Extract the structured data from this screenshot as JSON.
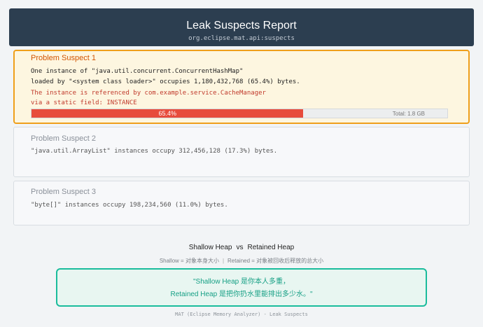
{
  "header": {
    "title": "Leak Suspects Report",
    "subtitle": "org.eclipse.mat.api:suspects"
  },
  "suspects": [
    {
      "title": "Problem Suspect 1",
      "line1": "One instance of \"java.util.concurrent.ConcurrentHashMap\"",
      "line2": "loaded by \"<system class loader>\" occupies 1,180,432,768 (65.4%) bytes.",
      "ref1": "The instance is referenced by com.example.service.CacheManager",
      "ref2": "via a static field: INSTANCE",
      "bar": {
        "fraction": 0.654,
        "label": "65.4%",
        "total": "Total: 1.8 GB"
      },
      "accent": "#ef9f1a"
    },
    {
      "title": "Problem Suspect 2",
      "line1": "\"java.util.ArrayList\" instances occupy 312,456,128 (17.3%) bytes."
    },
    {
      "title": "Problem Suspect 3",
      "line1": "\"byte[]\" instances occupy 198,234,560 (11.0%) bytes."
    }
  ],
  "heap": {
    "shallow": "Shallow Heap",
    "vs": "vs",
    "retained": "Retained Heap",
    "def_shallow": "Shallow = 对象本身大小",
    "sep": "|",
    "def_retained": "Retained = 对象被回收后释放的总大小",
    "quote_line1": "\"Shallow Heap 是你本人多重，",
    "quote_line2": "Retained Heap 是把你扔水里能排出多少水。\""
  },
  "footer": "MAT (Eclipse Memory Analyzer) - Leak Suspects",
  "colors": {
    "header_bg": "#2c3e50",
    "bar_fill": "#e74c3c",
    "quote_border": "#1abc9c"
  }
}
